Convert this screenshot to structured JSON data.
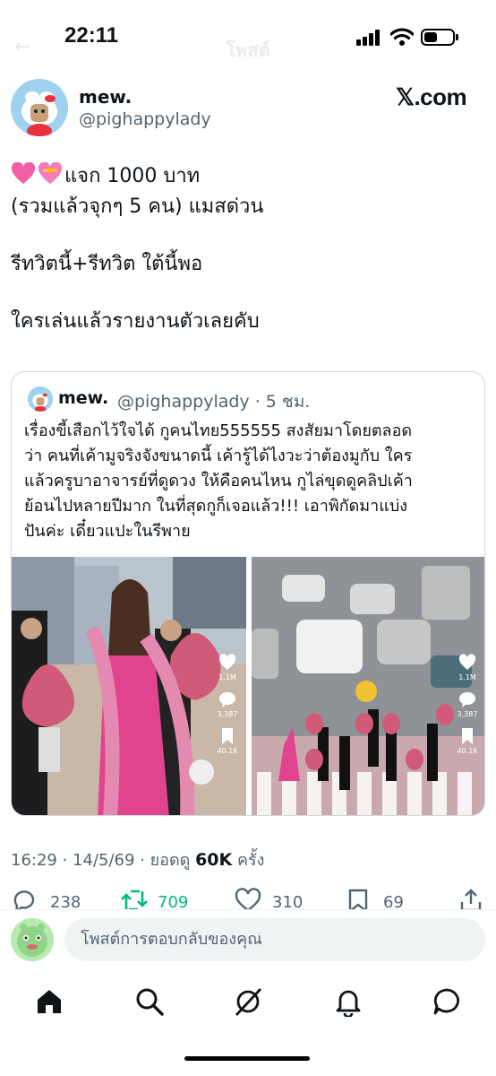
{
  "status_bar": {
    "time": "22:11"
  },
  "faded_header": {
    "title": "โพสต์"
  },
  "post": {
    "author": {
      "name": "mew.",
      "handle": "@pighappylady"
    },
    "watermark": "𝕏.com",
    "lines": [
      "แจก 1000 บาท",
      "(รวมแล้วจุกๆ 5 คน) แมสด่วน",
      "รีทวิตนี้+รีทวิต ใต้นี้พอ",
      "ใครเล่นแล้วรายงานตัวเลยคับ"
    ],
    "emojis": [
      "pink-heart-icon",
      "heart-with-ribbon-icon"
    ]
  },
  "quote": {
    "name": "mew.",
    "handle_time": "@pighappylady · 5 ชม.",
    "lines": [
      "เรื่องขี้เสือกไว้ใจได้ กูคนไทย555555 สงสัยมาโดยตลอด",
      "ว่า คนที่เค้ามูจริงจังขนาดนี้ เค้ารู้ได้ไงวะว่าต้องมูกับ ใคร",
      "แล้วครูบาอาจารย์ที่ดูดวง ให้คือคนไหน กูไล่ขุดดูคลิปเค้า",
      "ย้อนไปหลายปีมาก ในที่สุดกูก็เจอแล้ว!!! เอาพิกัดมาแบ่ง",
      "ปันค่ะ เดี๋ยวแปะในรีพาย"
    ],
    "media_left": {
      "likes": "1.1M",
      "comments": "3,387",
      "saves": "40.1K"
    },
    "media_right": {
      "likes": "1.1M",
      "comments": "3,387",
      "saves": "40.1K"
    }
  },
  "meta": {
    "time_date": "16:29 · 14/5/69 · ยอดดู ",
    "views": "60K",
    "views_suffix": " ครั้ง"
  },
  "actions": {
    "replies": "238",
    "retweets": "709",
    "likes": "310",
    "bookmarks": "69"
  },
  "reply_bar": {
    "placeholder": "โพสต์การตอบกลับของคุณ"
  },
  "tabs": [
    "home-icon",
    "search-icon",
    "grok-icon",
    "notifications-icon",
    "messages-icon"
  ],
  "colors": {
    "text": "#0f1419",
    "secondary": "#536471",
    "retweet_active": "#00ba7c",
    "border": "#cfd9de"
  }
}
